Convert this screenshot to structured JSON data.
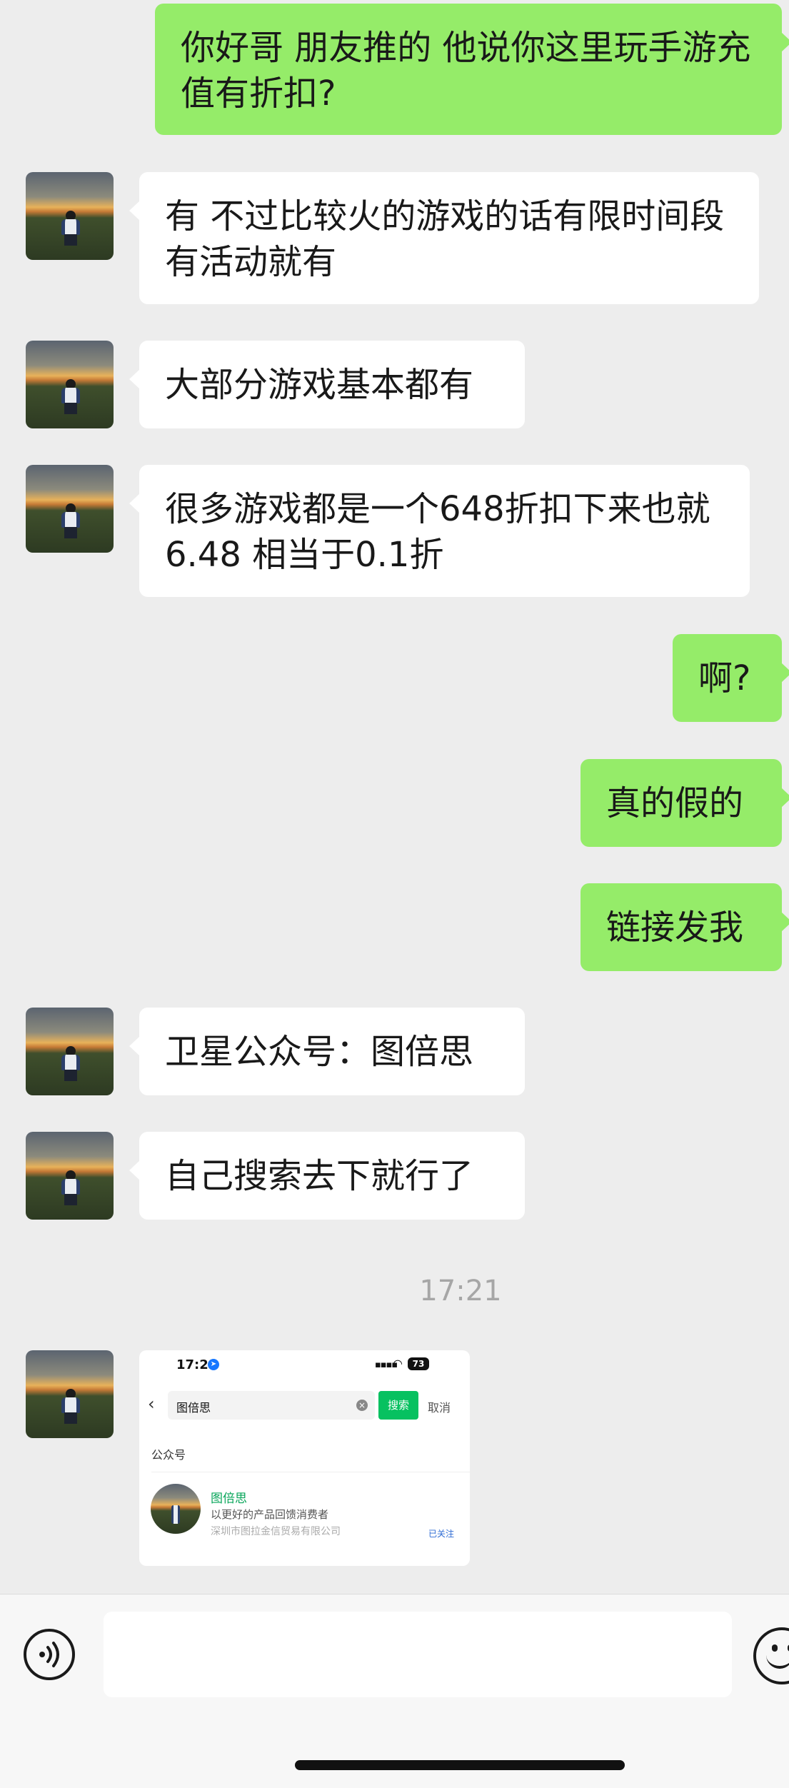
{
  "messages": [
    {
      "side": "right",
      "text": "你好哥 朋友推的 他说你这里玩手游充值有折扣?"
    },
    {
      "side": "left",
      "text": "有 不过比较火的游戏的话有限时间段  有活动就有"
    },
    {
      "side": "left",
      "text": "大部分游戏基本都有"
    },
    {
      "side": "left",
      "text": "很多游戏都是一个648折扣下来也就6.48 相当于0.1折"
    },
    {
      "side": "right",
      "text": "啊?"
    },
    {
      "side": "right",
      "text": "真的假的"
    },
    {
      "side": "right",
      "text": "链接发我"
    },
    {
      "side": "left",
      "text": "卫星公众号：图倍思"
    },
    {
      "side": "left",
      "text": "自己搜索去下就行了"
    }
  ],
  "timestamp": "17:21",
  "image_message": {
    "status_time": "17:21",
    "battery": "73",
    "search_query": "图倍思",
    "search_button": "搜索",
    "cancel": "取消",
    "section_label": "公众号",
    "account_name": "图倍思",
    "account_desc": "以更好的产品回馈消费者",
    "account_org": "深圳市图拉金信贸易有限公司",
    "follow_status": "已关注"
  },
  "input": {
    "value": ""
  },
  "icons": {
    "voice": "voice-icon",
    "emoji": "emoji-icon",
    "avatar": "contact-avatar"
  }
}
